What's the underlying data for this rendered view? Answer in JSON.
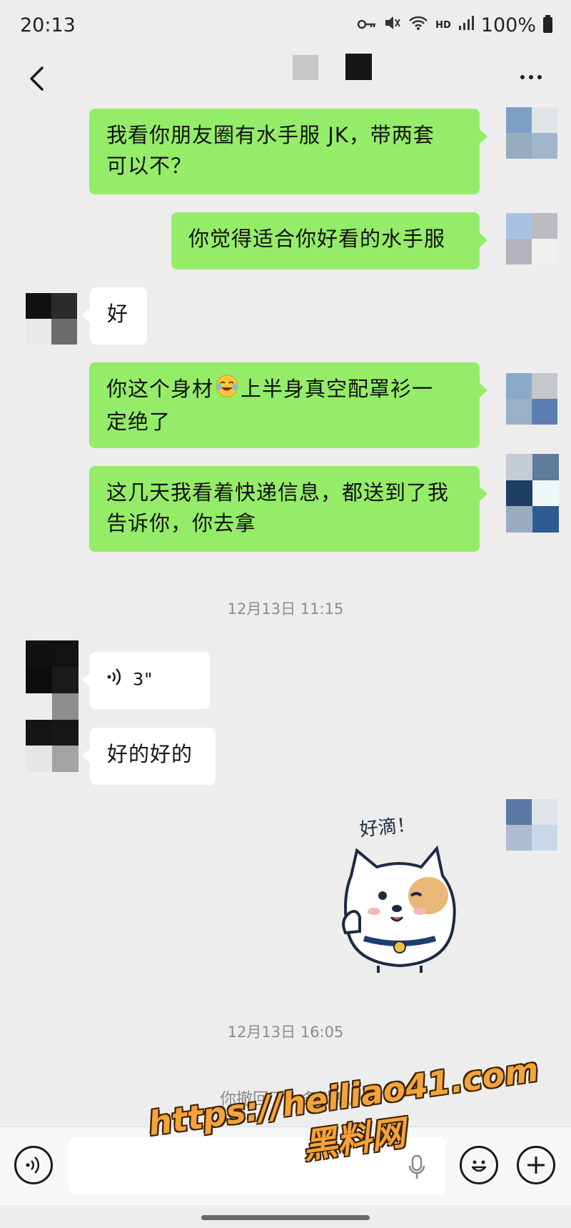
{
  "status_bar": {
    "time": "20:13",
    "hd_label": "HD",
    "battery": "100%"
  },
  "nav": {
    "title_icons": [
      "gray-square-icon",
      "black-square-icon"
    ]
  },
  "messages": [
    {
      "side": "out",
      "text_line1": "我看你朋友圈有水手服 JK，带两套",
      "text_line2": "可以不？"
    },
    {
      "side": "out",
      "text": "你觉得适合你好看的水手服"
    },
    {
      "side": "in",
      "text": "好"
    },
    {
      "side": "out",
      "text_line1": "你这个身材",
      "emoji": "laughing-crying-emoji",
      "text_line1_rest": "上半身真空配罩衫一",
      "text_line2": "定绝了"
    },
    {
      "side": "out",
      "text_line1": "这几天我看着快递信息，都送到了我",
      "text_line2": "告诉你，你去拿"
    },
    {
      "side": "in",
      "type": "voice",
      "duration": "3\""
    },
    {
      "side": "in",
      "text": "好的好的"
    },
    {
      "side": "out",
      "type": "sticker",
      "sticker_text": "好滴！"
    }
  ],
  "time_separators": [
    "12月13日 11:15",
    "12月13日 16:05"
  ],
  "recall_note": "你撤回了一条消息",
  "input_bar": {
    "placeholder": "",
    "icons": [
      "voice-mode-icon",
      "microphone-icon",
      "emoji-icon",
      "plus-icon"
    ]
  },
  "watermark": {
    "url": "https://heiliao41.com",
    "name": "黑料网"
  },
  "colors": {
    "background": "#ededed",
    "outgoing_bubble": "#95ec69",
    "incoming_bubble": "#ffffff",
    "watermark": "#f4a23a"
  }
}
